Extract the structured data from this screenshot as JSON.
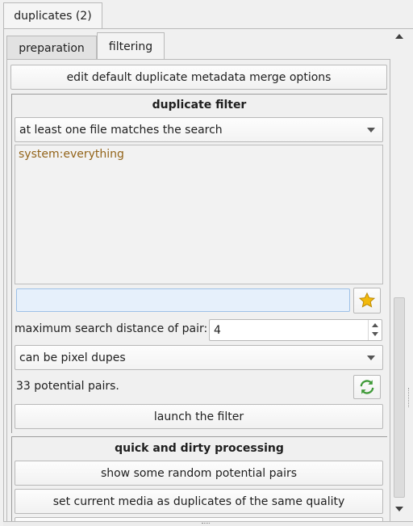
{
  "outer_tab": {
    "label": "duplicates (2)"
  },
  "tabs": [
    {
      "label": "preparation"
    },
    {
      "label": "filtering"
    }
  ],
  "merge_options_button": {
    "label": "edit default duplicate metadata merge options"
  },
  "duplicate_filter": {
    "heading": "duplicate filter",
    "match_mode": "at least one file matches the search",
    "predicates": [
      "system:everything"
    ],
    "search_input": {
      "value": "",
      "placeholder": ""
    },
    "max_distance": {
      "label": "maximum search distance of pair:",
      "value": "4"
    },
    "pixel_dupes": "can be pixel dupes",
    "potential_pairs": "33 potential pairs.",
    "launch_label": "launch the filter"
  },
  "quick_dirty": {
    "heading": "quick and dirty processing",
    "show_random_label": "show some random potential pairs",
    "set_duplicates_label": "set current media as duplicates of the same quality"
  },
  "icons": {
    "favourite": "star-icon",
    "refresh": "refresh-icon"
  },
  "colors": {
    "predicate_text": "#93641a",
    "star": "#f2b90c",
    "refresh": "#3f9a38",
    "search_bg": "#e6f0fb"
  }
}
